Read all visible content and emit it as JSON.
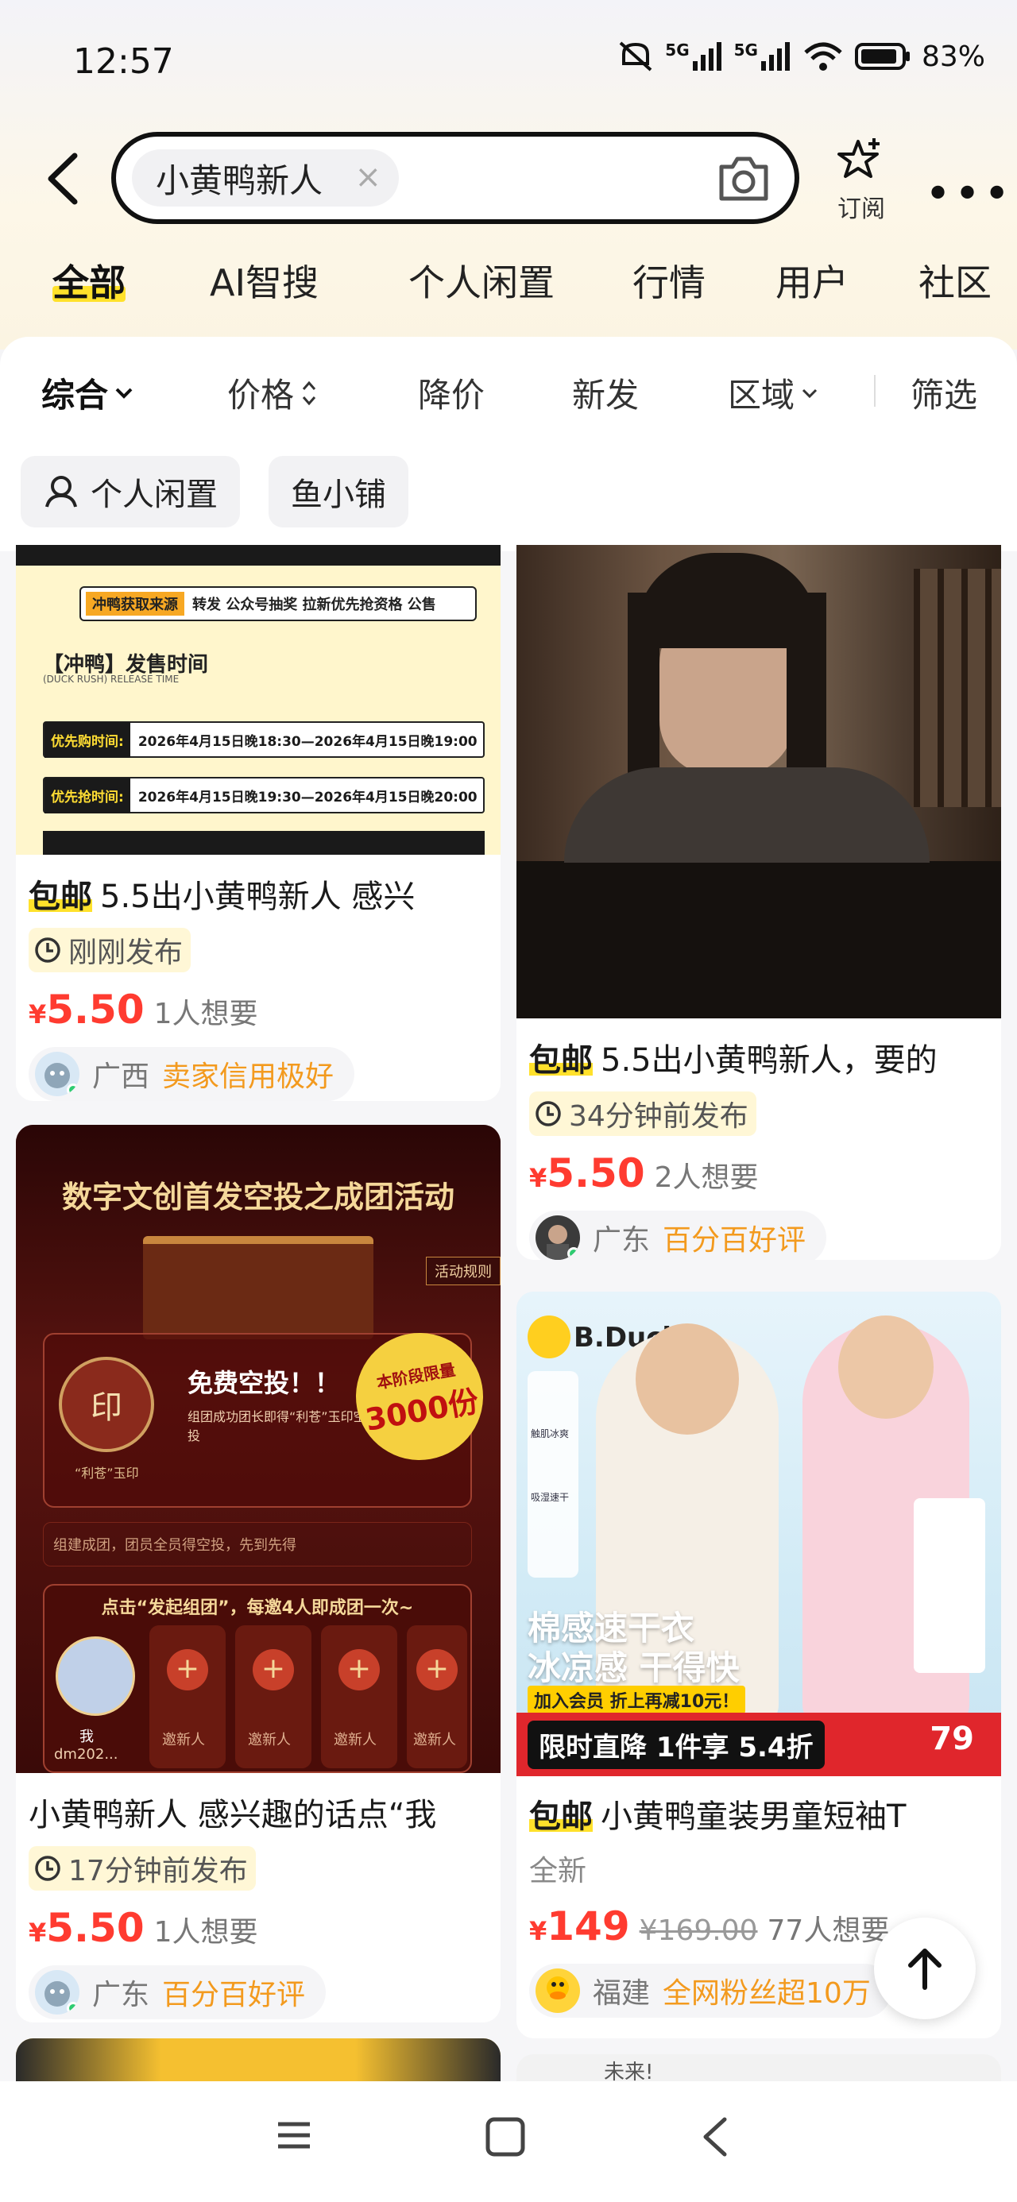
{
  "status": {
    "time": "12:57",
    "net1": "5G",
    "net2": "5G",
    "battery": "83%"
  },
  "search": {
    "query": "小黄鸭新人",
    "clear": "×",
    "subscribe_label": "订阅",
    "more": "•••"
  },
  "tabs": [
    {
      "label": "全部",
      "active": true
    },
    {
      "label": "AI智搜"
    },
    {
      "label": "个人闲置"
    },
    {
      "label": "行情"
    },
    {
      "label": "用户"
    },
    {
      "label": "社区"
    }
  ],
  "filters": [
    {
      "label": "综合",
      "active": true
    },
    {
      "label": "价格"
    },
    {
      "label": "降价"
    },
    {
      "label": "新发"
    },
    {
      "label": "区域"
    },
    {
      "label": "筛选"
    }
  ],
  "chips": [
    "个人闲置",
    "鱼小铺"
  ],
  "cards": [
    {
      "baoyou": "包邮",
      "title": "5.5出小黄鸭新人 感兴",
      "time": "刚刚发布",
      "price": "5.50",
      "yen": "¥",
      "wants": "1人想要",
      "region": "广西",
      "tag": "卖家信用极好",
      "image": {
        "source": "冲鸭获取来源",
        "channels": "转发 公众号抽奖 拉新优先抢资格 公售",
        "release_title": "【冲鸭】发售时间",
        "release_subtitle": "(DUCK RUSH) RELEASE TIME",
        "row1_label": "优先购时间:",
        "row1_value": "2026年4月15日晚18:30—2026年4月15日晚19:00",
        "row2_label": "优先抢时间:",
        "row2_value": "2026年4月15日晚19:30—2026年4月15日晚20:00"
      }
    },
    {
      "baoyou": "包邮",
      "title": "5.5出小黄鸭新人，要的",
      "time": "34分钟前发布",
      "price": "5.50",
      "yen": "¥",
      "wants": "2人想要",
      "region": "广东",
      "tag": "百分百好评"
    },
    {
      "title": "小黄鸭新人 感兴趣的话点“我",
      "time": "17分钟前发布",
      "price": "5.50",
      "yen": "¥",
      "wants": "1人想要",
      "region": "广东",
      "tag": "百分百好评",
      "image": {
        "headline": "数字文创首发空投之成团活动",
        "rules": "活动规则",
        "free": "免费空投！！",
        "desc": "组团成功团长即得“利苍”玉印空投",
        "seal_label": "“利苍”玉印",
        "limit_line1": "本阶段限量",
        "limit_line2": "3000份",
        "note": "组建成团，团员全员得空投，先到先得",
        "cta": "点击“发起组团”，每邀4人即成团一次~",
        "me": "我",
        "user": "dm202...",
        "invite": "邀新人"
      }
    },
    {
      "baoyou": "包邮",
      "title": "小黄鸭童装男童短袖T",
      "condition": "全新",
      "price": "149",
      "yen": "¥",
      "orig_price": "¥169.00",
      "wants": "77人想要",
      "region": "福建",
      "tag": "全网粉丝超10万",
      "image": {
        "brand": "B.Duck",
        "promo1": "棉感速干衣",
        "promo2": "冰凉感 干得快",
        "member": "加入会员 折上再减10元！",
        "banner": "限时直降 1件享 5.4折",
        "price_tag": "79",
        "icon1": "触肌冰爽",
        "icon2": "吸湿速干"
      }
    }
  ],
  "partial_card": {
    "text": "未来!"
  },
  "colors": {
    "accent": "#ffe12b",
    "price": "#ff3b30",
    "tag": "#f39a1e"
  }
}
